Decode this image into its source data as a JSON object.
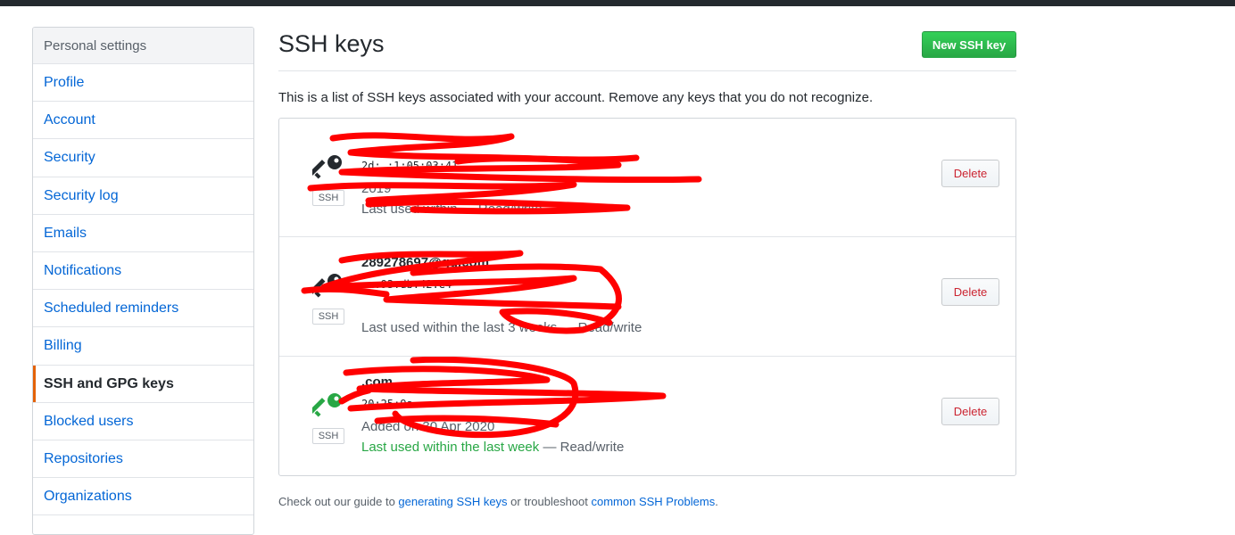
{
  "sidebar": {
    "header": "Personal settings",
    "items": [
      {
        "label": "Profile"
      },
      {
        "label": "Account"
      },
      {
        "label": "Security"
      },
      {
        "label": "Security log"
      },
      {
        "label": "Emails"
      },
      {
        "label": "Notifications"
      },
      {
        "label": "Scheduled reminders"
      },
      {
        "label": "Billing"
      },
      {
        "label": "SSH and GPG keys",
        "selected": true
      },
      {
        "label": "Blocked users"
      },
      {
        "label": "Repositories"
      },
      {
        "label": "Organizations"
      }
    ]
  },
  "main": {
    "title": "SSH keys",
    "new_key_button": "New SSH key",
    "intro": "This is a list of SSH keys associated with your account. Remove any keys that you do not recognize.",
    "keys": [
      {
        "title": "",
        "fingerprint": "2d:                                        :1:05:03:41",
        "added": "                2019",
        "used_prefix": "Last used within",
        "used_recent": "",
        "used_suffix": "— Read/write",
        "badge": "SSH",
        "icon_color": "#24292e",
        "delete_label": "Delete"
      },
      {
        "title": "289278697@qq.com",
        "fingerprint": "                                        :a:93:db:42:e4",
        "added": "",
        "used_prefix": "Last used within the last 3 weeks — Read/write",
        "used_recent": "",
        "used_suffix": "",
        "badge": "SSH",
        "icon_color": "#24292e",
        "delete_label": "Delete"
      },
      {
        "title": "              .com",
        "fingerprint": "                                        20:25:9a",
        "added": "Added on 30 Apr 2020",
        "used_prefix": "",
        "used_recent": "Last used within the last week",
        "used_suffix": " — Read/write",
        "badge": "SSH",
        "icon_color": "#28a745",
        "delete_label": "Delete"
      }
    ],
    "footer": {
      "prefix": "Check out our guide to ",
      "link1": "generating SSH keys",
      "middle": " or troubleshoot ",
      "link2": "common SSH Problems",
      "suffix": "."
    }
  },
  "colors": {
    "topbar": "#24292e",
    "link": "#0366d6",
    "primary_button": "#2ea44f",
    "danger": "#cb2431",
    "selected_accent": "#e36209",
    "redaction": "#ff0000"
  }
}
